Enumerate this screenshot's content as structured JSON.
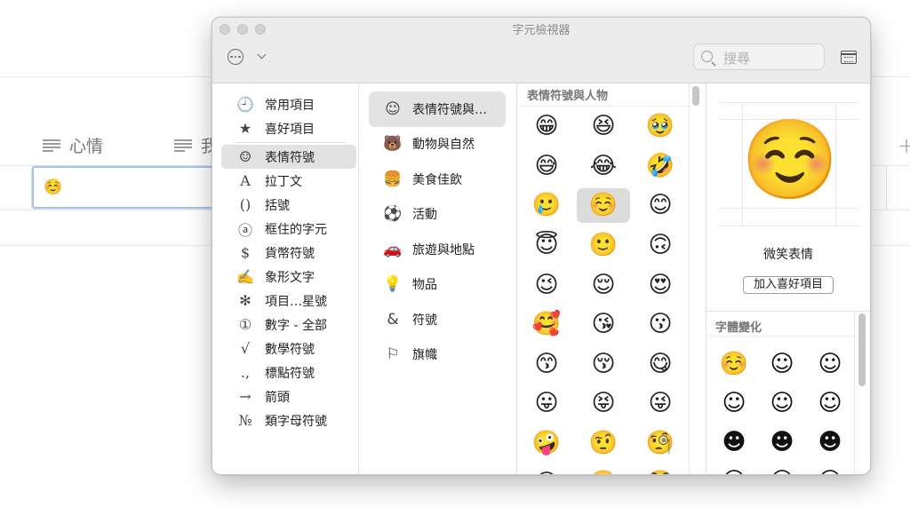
{
  "background": {
    "column_headers": [
      "心情",
      "我"
    ],
    "cell_value": "☺️",
    "add_symbol": "+"
  },
  "window": {
    "title": "字元檢視器",
    "search_placeholder": "搜尋"
  },
  "sidebar": {
    "items": [
      {
        "icon": "🕘",
        "label": "常用項目"
      },
      {
        "icon": "★",
        "label": "喜好項目"
      },
      {
        "icon": "☺",
        "label": "表情符號"
      },
      {
        "icon": "A",
        "label": "拉丁文"
      },
      {
        "icon": "()",
        "label": "括號"
      },
      {
        "icon": "ⓐ",
        "label": "框住的字元"
      },
      {
        "icon": "$",
        "label": "貨幣符號"
      },
      {
        "icon": "✍",
        "label": "象形文字"
      },
      {
        "icon": "✻",
        "label": "項目…星號"
      },
      {
        "icon": "①",
        "label": "數字 - 全部"
      },
      {
        "icon": "√",
        "label": "數學符號"
      },
      {
        "icon": ".,",
        "label": "標點符號"
      },
      {
        "icon": "→",
        "label": "箭頭"
      },
      {
        "icon": "№",
        "label": "類字母符號"
      }
    ]
  },
  "categories": {
    "items": [
      {
        "icon": "☺",
        "label": "表情符號與…"
      },
      {
        "icon": "🐻",
        "label": "動物與自然"
      },
      {
        "icon": "🍔",
        "label": "美食佳飲"
      },
      {
        "icon": "⚽",
        "label": "活動"
      },
      {
        "icon": "🚗",
        "label": "旅遊與地點"
      },
      {
        "icon": "💡",
        "label": "物品"
      },
      {
        "icon": "&",
        "label": "符號"
      },
      {
        "icon": "⚐",
        "label": "旗幟"
      }
    ]
  },
  "grid": {
    "header": "表情符號與人物",
    "emojis": [
      "😁",
      "😆",
      "🥹",
      "😅",
      "😂",
      "🤣",
      "🥲",
      "☺️",
      "😊",
      "😇",
      "🙂",
      "🙃",
      "😉",
      "😌",
      "😍",
      "🥰",
      "😘",
      "😗",
      "😙",
      "😚",
      "😋",
      "😛",
      "😝",
      "😜",
      "🤪",
      "🤨",
      "🧐",
      "😎",
      "🤓",
      "🥸"
    ]
  },
  "detail": {
    "emoji": "☺️",
    "name": "微笑表情",
    "add_favorite": "加入喜好項目",
    "variants_header": "字體變化",
    "variants": [
      "☺️",
      "☺",
      "☺",
      "☺",
      "☺",
      "☺",
      "☻",
      "☻",
      "☻",
      "☺",
      "☺",
      "☺"
    ]
  }
}
